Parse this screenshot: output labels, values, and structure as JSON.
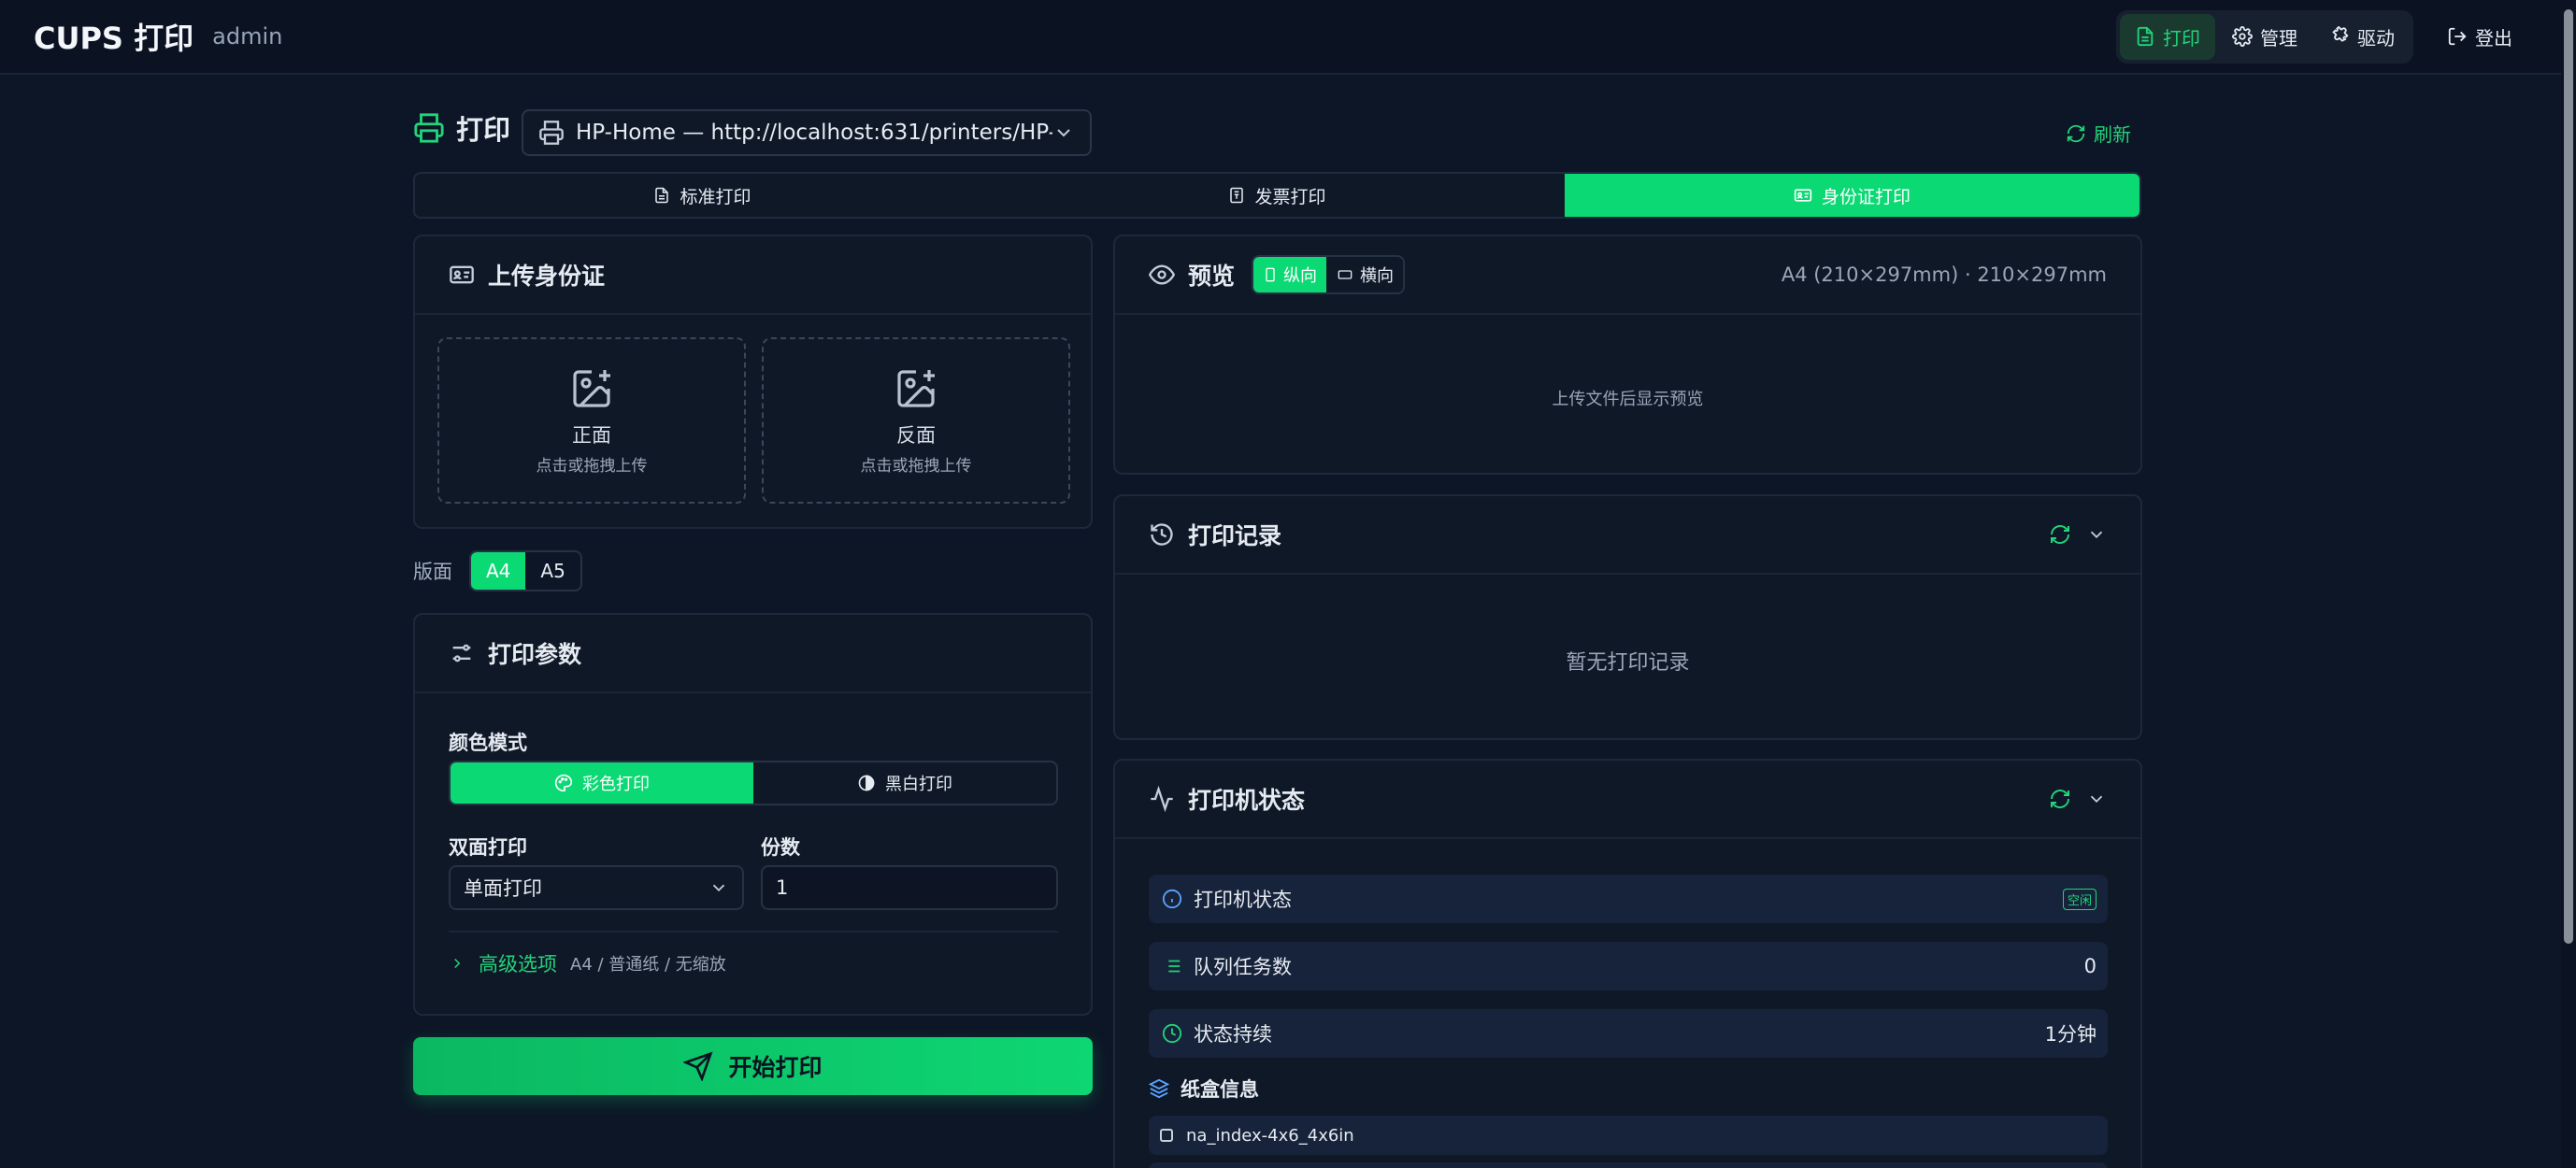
{
  "app": {
    "title": "CUPS 打印",
    "user": "admin"
  },
  "topnav": {
    "print": "打印",
    "manage": "管理",
    "drivers": "驱动",
    "logout": "登出"
  },
  "print_header": {
    "title": "打印",
    "printer_selected": "HP-Home — http://localhost:631/printers/HP-Ho···",
    "refresh": "刷新"
  },
  "mode_tabs": {
    "standard": "标准打印",
    "invoice": "发票打印",
    "idcard": "身份证打印"
  },
  "upload": {
    "title": "上传身份证",
    "front_label": "正面",
    "front_hint": "点击或拖拽上传",
    "back_label": "反面",
    "back_hint": "点击或拖拽上传"
  },
  "layout": {
    "label": "版面",
    "options": [
      "A4",
      "A5"
    ],
    "selected": "A4"
  },
  "params": {
    "title": "打印参数",
    "color_mode_label": "颜色模式",
    "color": "彩色打印",
    "mono": "黑白打印",
    "duplex_label": "双面打印",
    "duplex_value": "单面打印",
    "copies_label": "份数",
    "copies_value": "1",
    "advanced_label": "高级选项",
    "advanced_summary": "A4 / 普通纸 / 无缩放"
  },
  "start_button": "开始打印",
  "preview": {
    "title": "预览",
    "portrait": "纵向",
    "landscape": "横向",
    "info": "A4 (210×297mm) · 210×297mm",
    "empty": "上传文件后显示预览"
  },
  "history": {
    "title": "打印记录",
    "empty": "暂无打印记录"
  },
  "printer_status": {
    "title": "打印机状态",
    "status_label": "打印机状态",
    "status_badge": "空闲",
    "queue_label": "队列任务数",
    "queue_value": "0",
    "duration_label": "状态持续",
    "duration_value": "1分钟",
    "tray_title": "纸盒信息",
    "tray_first": "na_index-4x6_4x6in"
  },
  "colors": {
    "accent": "#0bd974",
    "background": "#0d1626",
    "card": "#0f1827"
  }
}
